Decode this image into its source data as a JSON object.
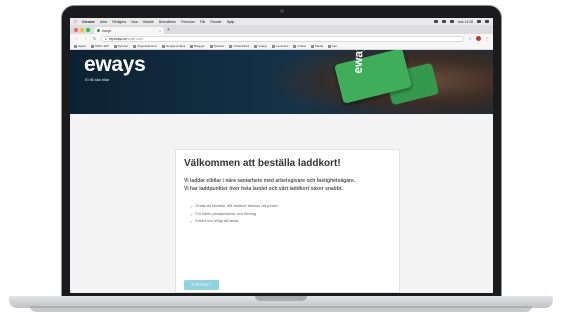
{
  "menubar": {
    "app_name": "Chrome",
    "items": [
      "Arkiv",
      "Redigera",
      "Visa",
      "Historik",
      "Bokmärken",
      "Personer",
      "Flik",
      "Fönster",
      "Hjälp"
    ],
    "clock": "tors 14:28"
  },
  "browser": {
    "tab_title": "eways",
    "url_host": "my.eways.se",
    "url_path": "/order-card",
    "bookmarks": [
      "Appar",
      "Office 365",
      "Nyheter",
      "Organisationer",
      "Google Analys",
      "Blogger",
      "Tjänster",
      "Infrastruktur",
      "Guays",
      "Leverans",
      "Ordrar",
      "Media",
      "Hur"
    ]
  },
  "hero": {
    "logo": "eways",
    "tagline": "El till alla bilar",
    "card_text": "eways"
  },
  "content": {
    "heading": "Välkommen att beställa laddkort!",
    "intro_1": "Vi laddar elbilar i nära samarbete med arbetsgivare och fastighetsägare.",
    "intro_2": "Vi har laddpunkter över hela landet och vårt laddkort växer snabbt.",
    "bullets": [
      "Gratis att beställa, ditt laddkort skickas via posten",
      "För både privatpersoner och företag",
      "Enkelt och billigt att ladda"
    ],
    "cta_label": "FORTSÄTT"
  },
  "colors": {
    "accent_green": "#3fae5a",
    "cta_blue": "#8fd2e0",
    "hero_navy": "#0c2233"
  },
  "dock": {
    "apps": [
      "finder",
      "safari",
      "calendar",
      "chrome",
      "notes",
      "photos",
      "mail",
      "preview",
      "photoshop",
      "spotify",
      "slack",
      "app-store",
      "system-preferences",
      "downloads",
      "trash"
    ]
  }
}
